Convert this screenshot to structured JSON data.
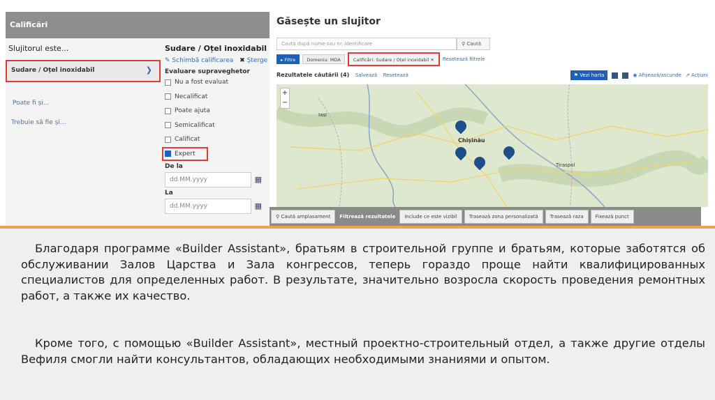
{
  "left_panel": {
    "header": "Calificări",
    "col_a_title": "Slujitorul este...",
    "selected_item": "Sudare / Oțel inoxidabil",
    "links": [
      "Poate fi și...",
      "Trebuie să fie și..."
    ]
  },
  "qualification": {
    "title": "Sudare / Oțel inoxidabil",
    "change_label": "Schimbă calificarea",
    "delete_label": "Șterge",
    "rating_title": "Evaluare supraveghetor",
    "options": [
      {
        "label": "Nu a fost evaluat",
        "checked": false
      },
      {
        "label": "Necalificat",
        "checked": false
      },
      {
        "label": "Poate ajuta",
        "checked": false
      },
      {
        "label": "Semicalificat",
        "checked": false
      },
      {
        "label": "Calificat",
        "checked": false
      },
      {
        "label": "Expert",
        "checked": true
      }
    ],
    "from_label": "De la",
    "to_label": "La",
    "date_placeholder": "dd.MM.yyyy"
  },
  "right_panel": {
    "title": "Găsește un slujitor",
    "search_placeholder": "Caută după nume sau nr. identificare",
    "search_button": "Caută",
    "filter_button": "Filtre",
    "filter_domain": "Domeniu: MDA",
    "filter_qual": "Calificări: Sudare / Oțel inoxidabil",
    "reset_filters": "Resetează filtrele",
    "results_title": "Rezultatele căutării (4)",
    "save": "Salvează",
    "reset": "Resetează",
    "map_button": "Vezi harta",
    "sort": "Afișează/ascunde",
    "actions": "Acțiuni"
  },
  "map": {
    "cities": [
      "Iași",
      "Chișinău",
      "Tiraspol"
    ],
    "pins": [
      "",
      "",
      "",
      ""
    ],
    "footer_buttons": {
      "search_location": "Caută amplasament",
      "filter_results": "Filtrează rezultatele",
      "include_visible": "Include ce este vizibil",
      "draw_custom": "Trasează zona personalizată",
      "draw_radius": "Trasează raza",
      "fix_point": "Fixează punct"
    }
  },
  "text": {
    "p1": "Благодаря программе «Builder Assistant», братьям в строительной группе и братьям, которые заботятся об обслуживании Залов Царства и Зала конгрессов, теперь гораздо проще найти квалифицированных специалистов для определенных работ. В результате, значительно возросла скорость проведения ремонтных работ, а также их качество.",
    "p2": "Кроме того, с помощью «Builder Assistant», местный проектно-строительный отдел, а также другие отделы Вефиля смогли найти консультантов, обладающих необходимыми знаниями и опытом."
  },
  "colors": {
    "accent": "#1e5fb8",
    "highlight": "#e53935",
    "separator": "#f0a24a"
  }
}
